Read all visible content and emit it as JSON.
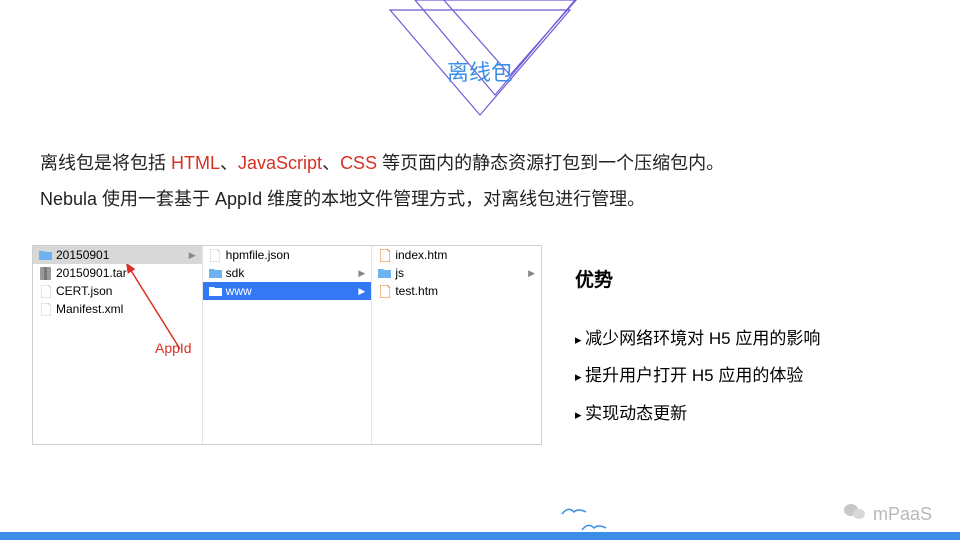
{
  "title": "离线包",
  "desc_parts": {
    "p1a": "离线包是将包括 ",
    "p1b": "HTML",
    "p1c": "、",
    "p1d": "JavaScript",
    "p1e": "、",
    "p1f": "CSS",
    "p1g": " 等页面内的静态资源打包到一个压缩包内。",
    "p2": "Nebula 使用一套基于 AppId 维度的本地文件管理方式，对离线包进行管理。"
  },
  "finder": {
    "col1": [
      {
        "icon": "folder",
        "label": "20150901",
        "sel": "gray",
        "arrow": true
      },
      {
        "icon": "archive",
        "label": "20150901.tar"
      },
      {
        "icon": "file",
        "label": "CERT.json"
      },
      {
        "icon": "file",
        "label": "Manifest.xml"
      }
    ],
    "col2": [
      {
        "icon": "file",
        "label": "hpmfile.json"
      },
      {
        "icon": "folder",
        "label": "sdk",
        "arrow": true
      },
      {
        "icon": "folder",
        "label": "www",
        "sel": "blue",
        "arrow": true
      }
    ],
    "col3": [
      {
        "icon": "html",
        "label": "index.htm"
      },
      {
        "icon": "folder",
        "label": "js",
        "arrow": true
      },
      {
        "icon": "html",
        "label": "test.htm"
      }
    ]
  },
  "annotation": "AppId",
  "advantages": {
    "title": "优势",
    "items": [
      "减少网络环境对 H5 应用的影响",
      "提升用户打开 H5 应用的体验",
      "实现动态更新"
    ]
  },
  "brand": "mPaaS"
}
